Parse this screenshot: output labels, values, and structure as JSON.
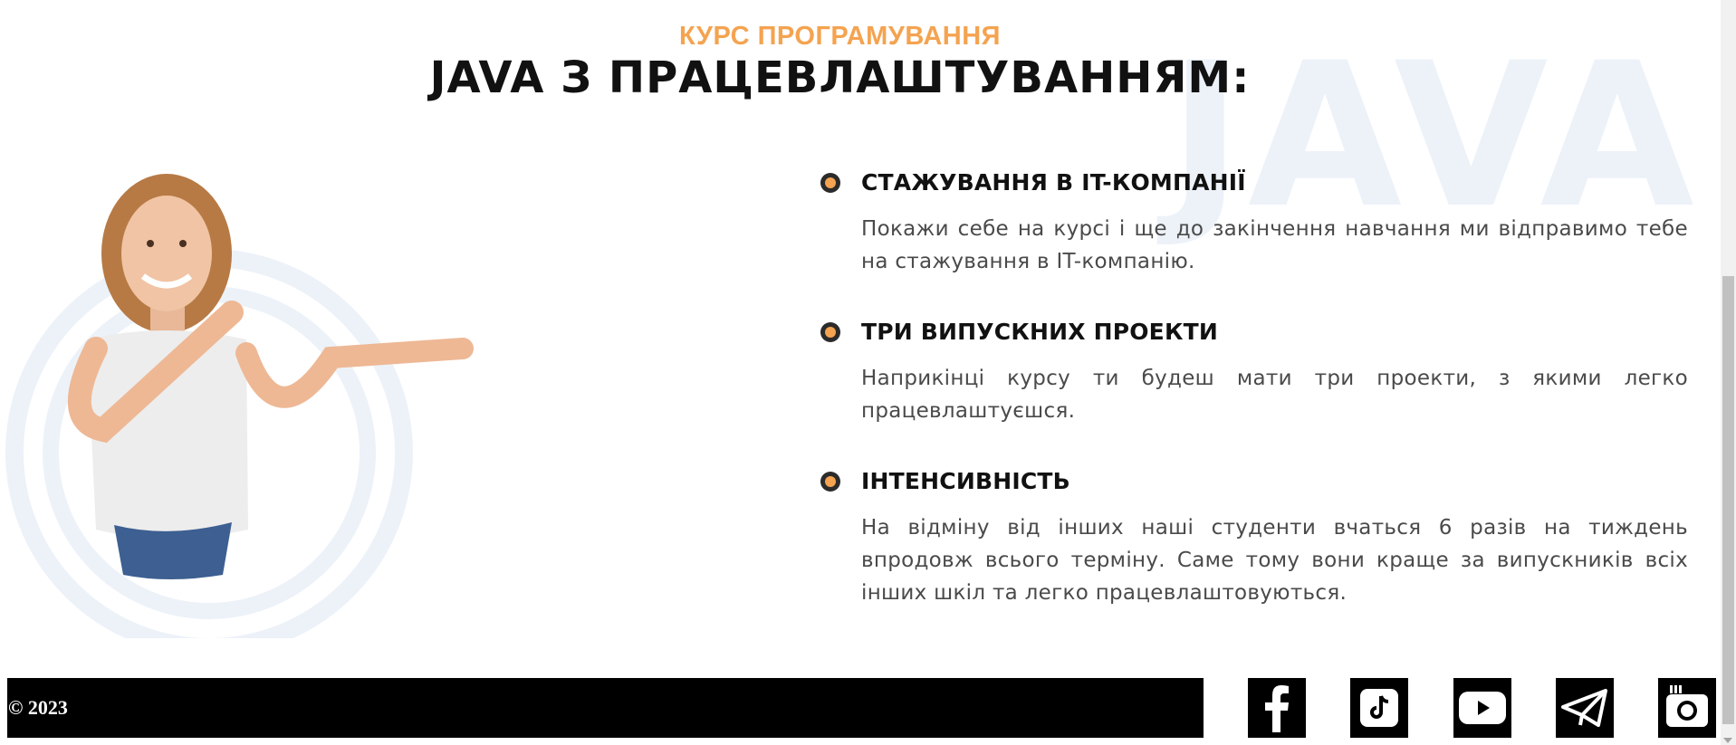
{
  "hero": {
    "watermark": "JAVA",
    "subtitle": "КУРС ПРОГРАМУВАННЯ",
    "title": "JAVA З ПРАЦЕВЛАШТУВАННЯМ:"
  },
  "features": [
    {
      "title": "СТАЖУВАННЯ В IT-КОМПАНІЇ",
      "text": "Покажи себе на курсі і ще до закінчення навчання ми відправимо тебе на стажування в IT-компанію."
    },
    {
      "title": "ТРИ ВИПУСКНИХ ПРОЕКТИ",
      "text": "Наприкінці курсу ти будеш мати три проекти, з якими легко працевлаштуєшся."
    },
    {
      "title": "ІНТЕНСИВНІСТЬ",
      "text": "На відміну від інших наші студенти вчаться 6 разів на тиждень впродовж всього терміну. Саме тому вони краще за випускників всіх інших шкіл та легко працевлаштовуються."
    }
  ],
  "footer": {
    "copyright": "© 2023",
    "social": [
      "facebook-icon",
      "tiktok-icon",
      "youtube-icon",
      "telegram-icon",
      "instagram-icon"
    ]
  },
  "colors": {
    "accent": "#f4a350",
    "watermark": "#edf2f9",
    "footer_bg": "#000000"
  }
}
